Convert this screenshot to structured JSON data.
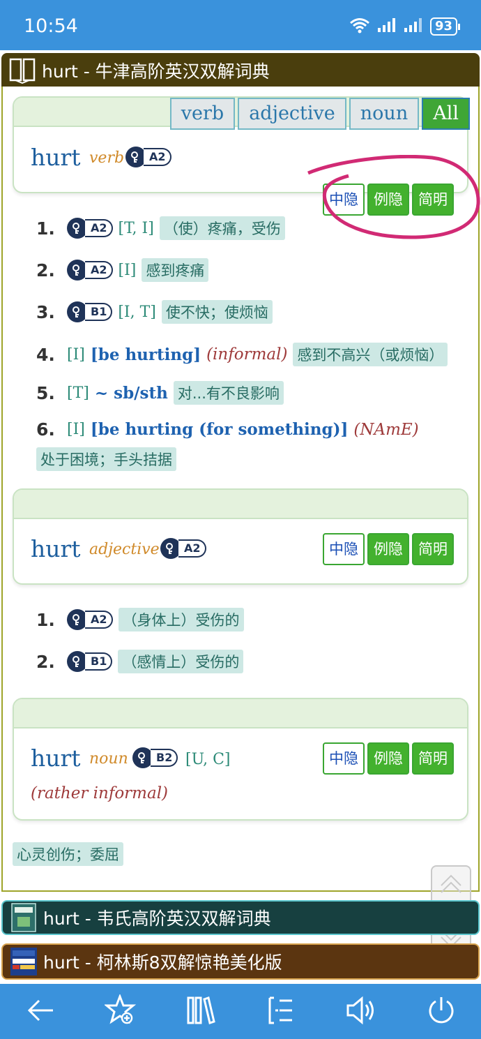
{
  "status_bar": {
    "time": "10:54",
    "battery": "93"
  },
  "dict1": {
    "title": "hurt - 牛津高阶英汉双解词典"
  },
  "dict2": {
    "title": "hurt - 韦氏高阶英汉双解词典"
  },
  "dict3": {
    "title": "hurt - 柯林斯8双解惊艳美化版"
  },
  "pos_tabs": [
    "verb",
    "adjective",
    "noun",
    "All"
  ],
  "buttons": {
    "hide_cn": "中隐",
    "hide_ex": "例隐",
    "simple": "简明"
  },
  "entries": [
    {
      "headword": "hurt",
      "pos": "verb",
      "level": "A2",
      "senses": [
        {
          "num": "1.",
          "level": "A2",
          "gram": "[T, I]",
          "zh": "（使）疼痛，受伤"
        },
        {
          "num": "2.",
          "level": "A2",
          "gram": "[I]",
          "zh": "感到疼痛"
        },
        {
          "num": "3.",
          "level": "B1",
          "gram": "[I, T]",
          "zh": "使不快；使烦恼"
        },
        {
          "num": "4.",
          "gram": "[I]",
          "phrase": "[be hurting]",
          "reg": "(informal)",
          "zh": "感到不高兴（或烦恼）"
        },
        {
          "num": "5.",
          "gram": "[T]",
          "phrase": "~ sb/sth",
          "zh": "对...有不良影响"
        },
        {
          "num": "6.",
          "gram": "[I]",
          "phrase": "[be hurting (for something)]",
          "reg": "(NAmE)",
          "zh": "处于困境；手头拮据"
        }
      ]
    },
    {
      "headword": "hurt",
      "pos": "adjective",
      "level": "A2",
      "senses": [
        {
          "num": "1.",
          "level": "A2",
          "zh": "（身体上）受伤的"
        },
        {
          "num": "2.",
          "level": "B1",
          "zh": "（感情上）受伤的"
        }
      ]
    },
    {
      "headword": "hurt",
      "pos": "noun",
      "level": "B2",
      "gram": "[U, C]",
      "reg": "(rather informal)",
      "senses": [
        {
          "zh": "心灵创伤；委屈"
        }
      ]
    }
  ]
}
